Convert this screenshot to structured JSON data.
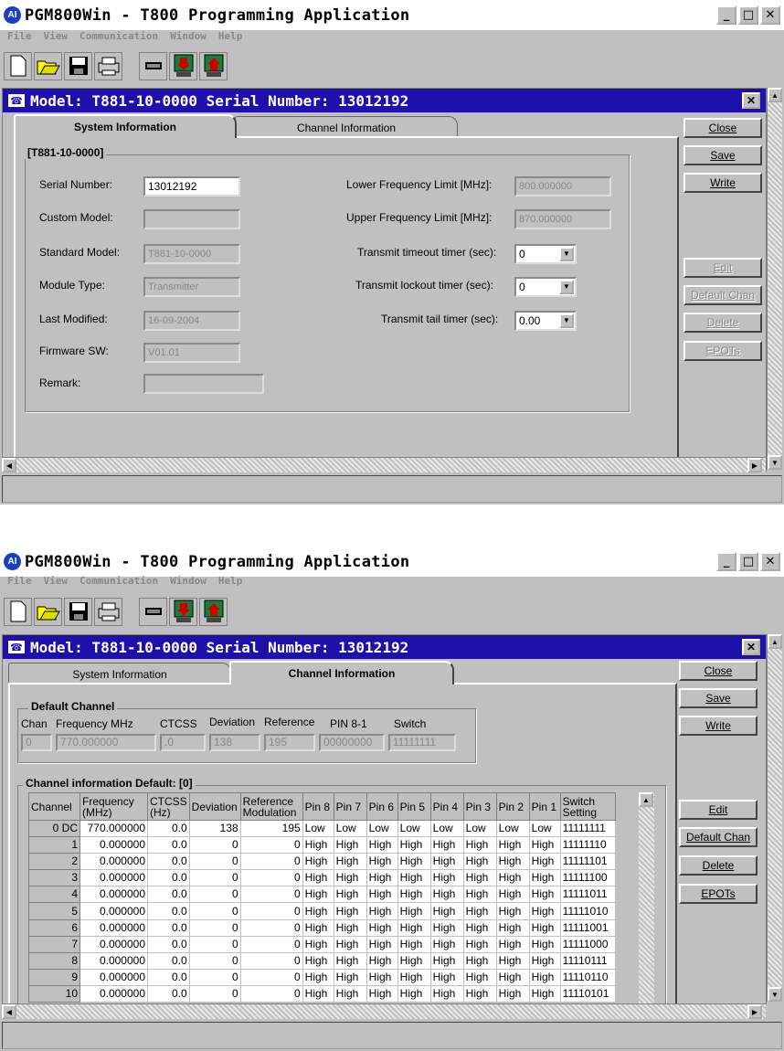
{
  "app": {
    "title": "PGM800Win - T800 Programming Application",
    "icon": "app-logo-icon",
    "menu": [
      "File",
      "View",
      "Communication",
      "Window",
      "Help"
    ],
    "buttons": {
      "minimize": "_",
      "maximize": "□",
      "close": "✕"
    }
  },
  "child": {
    "title": "Model: T881-10-0000 Serial Number: 13012192",
    "close": "✕"
  },
  "tabs": [
    "System Information",
    "Channel Information"
  ],
  "sidebar": {
    "close": "Close",
    "save": "Save",
    "write": "Write",
    "edit": "Edit",
    "default_chan": "Default Chan",
    "delete": "Delete",
    "epots": "EPOTs"
  },
  "sys": {
    "group_label": "[T881-10-0000]",
    "serial_label": "Serial Number:",
    "serial_value": "13012192",
    "custom_label": "Custom Model:",
    "custom_value": "",
    "standard_label": "Standard Model:",
    "standard_value": "T881-10-0000",
    "module_label": "Module Type:",
    "module_value": "Transmitter",
    "modified_label": "Last Modified:",
    "modified_value": "16-09-2004",
    "firmware_label": "Firmware SW:",
    "firmware_value": "V01.01",
    "remark_label": "Remark:",
    "remark_value": "",
    "lower_label": "Lower Frequency  Limit [MHz]:",
    "lower_value": "800.000000",
    "upper_label": "Upper Frequency  Limit [MHz]:",
    "upper_value": "870.000000",
    "tto_label": "Transmit timeout timer (sec):",
    "tto_value": "0",
    "tlo_label": "Transmit lockout timer (sec):",
    "tlo_value": "0",
    "ttail_label": "Transmit tail timer (sec):",
    "ttail_value": "0.00"
  },
  "default": {
    "group_label": "Default Channel",
    "chan_label": "Chan",
    "freq_label": "Frequency MHz",
    "ctcss_label": "CTCSS",
    "dev_label": "Deviation",
    "ref_label": "Reference",
    "pin_label": "PIN 8-1",
    "switch_label": "Switch",
    "chan": "0",
    "freq": "770.000000",
    "ctcss": ".0",
    "dev": "138",
    "ref": "195",
    "pin": "00000000",
    "switch": "11111111"
  },
  "chinfo": {
    "group_label": "Channel information  Default: [0]",
    "headers": [
      "Channel",
      "Frequency (MHz)",
      "CTCSS (Hz)",
      "Deviation",
      "Reference Modulation",
      "Pin 8",
      "Pin 7",
      "Pin 6",
      "Pin 5",
      "Pin 4",
      "Pin 3",
      "Pin 2",
      "Pin 1",
      "Switch Setting"
    ],
    "rows": [
      [
        "0 DC",
        "770.000000",
        "0.0",
        "138",
        "195",
        "Low",
        "Low",
        "Low",
        "Low",
        "Low",
        "Low",
        "Low",
        "Low",
        "11111111"
      ],
      [
        "1",
        "0.000000",
        "0.0",
        "0",
        "0",
        "High",
        "High",
        "High",
        "High",
        "High",
        "High",
        "High",
        "High",
        "11111110"
      ],
      [
        "2",
        "0.000000",
        "0.0",
        "0",
        "0",
        "High",
        "High",
        "High",
        "High",
        "High",
        "High",
        "High",
        "High",
        "11111101"
      ],
      [
        "3",
        "0.000000",
        "0.0",
        "0",
        "0",
        "High",
        "High",
        "High",
        "High",
        "High",
        "High",
        "High",
        "High",
        "11111100"
      ],
      [
        "4",
        "0.000000",
        "0.0",
        "0",
        "0",
        "High",
        "High",
        "High",
        "High",
        "High",
        "High",
        "High",
        "High",
        "11111011"
      ],
      [
        "5",
        "0.000000",
        "0.0",
        "0",
        "0",
        "High",
        "High",
        "High",
        "High",
        "High",
        "High",
        "High",
        "High",
        "11111010"
      ],
      [
        "6",
        "0.000000",
        "0.0",
        "0",
        "0",
        "High",
        "High",
        "High",
        "High",
        "High",
        "High",
        "High",
        "High",
        "11111001"
      ],
      [
        "7",
        "0.000000",
        "0.0",
        "0",
        "0",
        "High",
        "High",
        "High",
        "High",
        "High",
        "High",
        "High",
        "High",
        "11111000"
      ],
      [
        "8",
        "0.000000",
        "0.0",
        "0",
        "0",
        "High",
        "High",
        "High",
        "High",
        "High",
        "High",
        "High",
        "High",
        "11110111"
      ],
      [
        "9",
        "0.000000",
        "0.0",
        "0",
        "0",
        "High",
        "High",
        "High",
        "High",
        "High",
        "High",
        "High",
        "High",
        "11110110"
      ],
      [
        "10",
        "0.000000",
        "0.0",
        "0",
        "0",
        "High",
        "High",
        "High",
        "High",
        "High",
        "High",
        "High",
        "High",
        "11110101"
      ]
    ]
  }
}
